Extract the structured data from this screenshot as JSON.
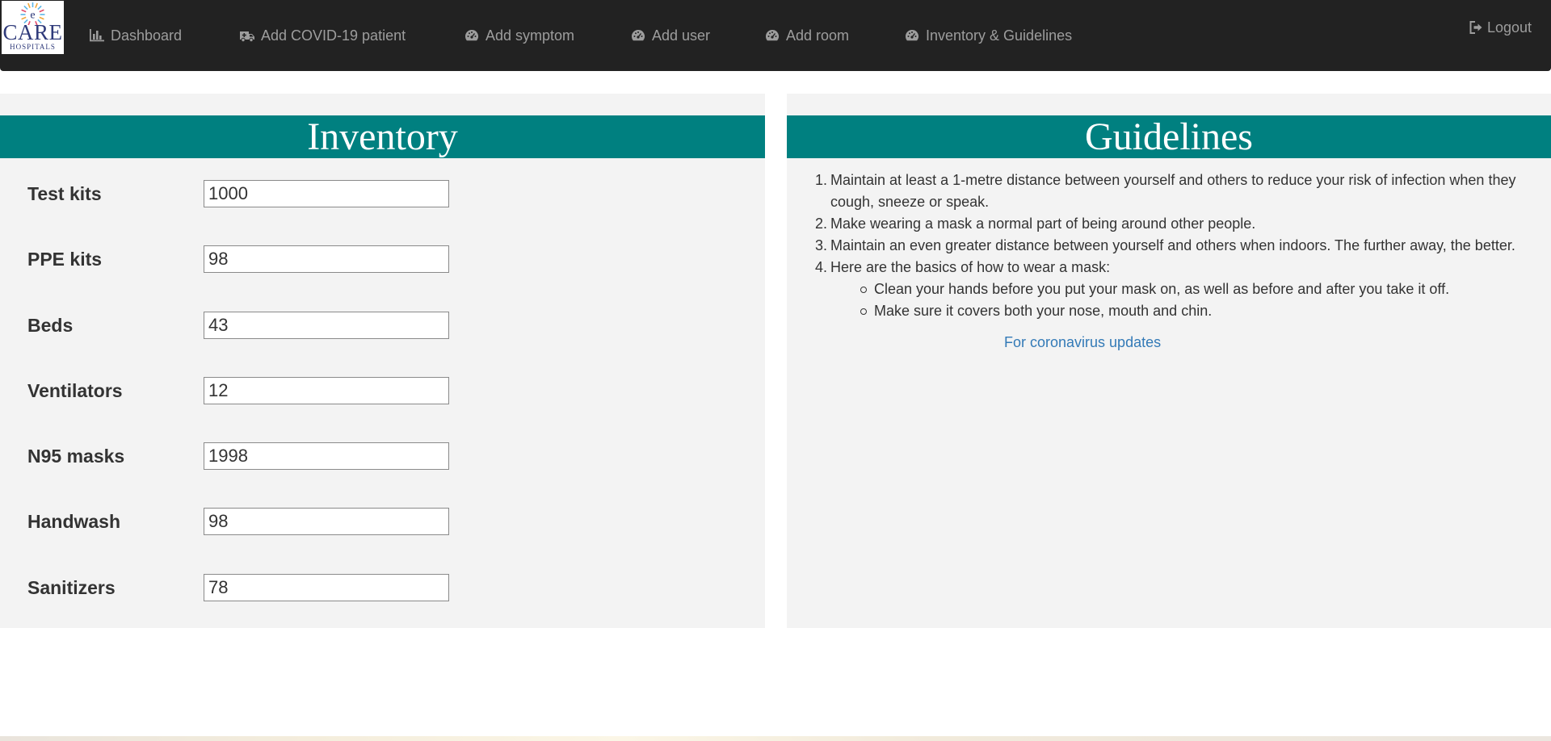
{
  "brand": {
    "logo_word": "CARE",
    "logo_sub": "HOSPITALS",
    "logo_mark": "e"
  },
  "nav": {
    "items": [
      {
        "label": "Dashboard",
        "icon": "bar-chart-icon"
      },
      {
        "label": "Add COVID-19 patient",
        "icon": "ambulance-icon"
      },
      {
        "label": "Add symptom",
        "icon": "dashboard-gauge-icon"
      },
      {
        "label": "Add user",
        "icon": "dashboard-gauge-icon"
      },
      {
        "label": "Add room",
        "icon": "dashboard-gauge-icon"
      },
      {
        "label": "Inventory & Guidelines",
        "icon": "dashboard-gauge-icon"
      }
    ],
    "logout": {
      "label": "Logout",
      "icon": "logout-icon"
    }
  },
  "inventory": {
    "title": "Inventory",
    "rows": [
      {
        "label": "Test kits",
        "value": "1000"
      },
      {
        "label": "PPE kits",
        "value": "98"
      },
      {
        "label": "Beds",
        "value": "43"
      },
      {
        "label": "Ventilators",
        "value": "12"
      },
      {
        "label": "N95 masks",
        "value": "1998"
      },
      {
        "label": "Handwash",
        "value": "98"
      },
      {
        "label": "Sanitizers",
        "value": "78"
      }
    ]
  },
  "guidelines": {
    "title": "Guidelines",
    "items": [
      {
        "num": "1.",
        "text": "Maintain at least a 1-metre distance between yourself and others to reduce your risk of infection when they cough, sneeze or speak."
      },
      {
        "num": "2.",
        "text": "Make wearing a mask a normal part of being around other people."
      },
      {
        "num": "3.",
        "text": "Maintain an even greater distance between yourself and others when indoors. The further away, the better."
      },
      {
        "num": "4.",
        "text": "Here are the basics of how to wear a mask:"
      }
    ],
    "subitems": [
      "Clean your hands before you put your mask on, as well as before and after you take it off.",
      "Make sure it covers both your nose, mouth and chin."
    ],
    "link": "For coronavirus updates"
  },
  "colors": {
    "navbar_bg": "#222222",
    "nav_text": "#9d9d9d",
    "header_teal": "#008080",
    "panel_bg": "#f3f3f3",
    "link": "#337ab7"
  }
}
